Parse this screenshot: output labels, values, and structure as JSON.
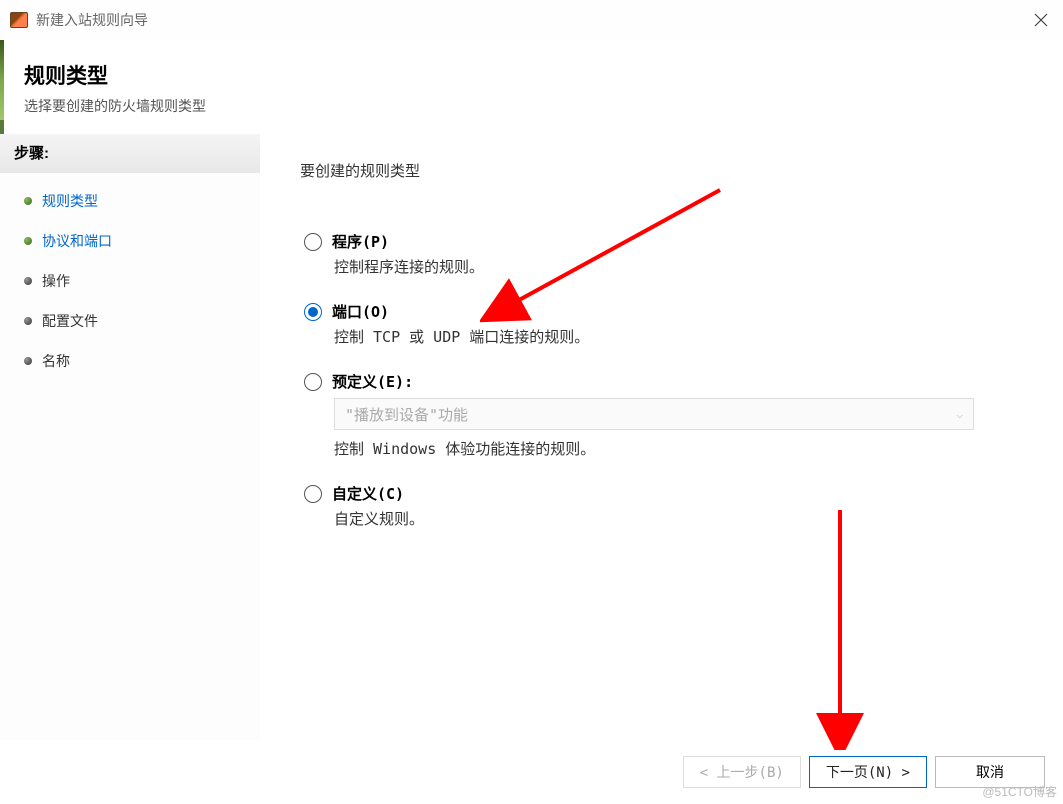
{
  "titlebar": {
    "title": "新建入站规则向导"
  },
  "header": {
    "title": "规则类型",
    "subtitle": "选择要创建的防火墙规则类型"
  },
  "sidebar": {
    "title": "步骤:",
    "items": [
      {
        "label": "规则类型",
        "current": false,
        "link": true
      },
      {
        "label": "协议和端口",
        "current": true,
        "link": true
      },
      {
        "label": "操作",
        "current": false,
        "link": false
      },
      {
        "label": "配置文件",
        "current": false,
        "link": false
      },
      {
        "label": "名称",
        "current": false,
        "link": false
      }
    ]
  },
  "main": {
    "title": "要创建的规则类型",
    "options": [
      {
        "label": "程序(P)",
        "desc": "控制程序连接的规则。",
        "checked": false
      },
      {
        "label": "端口(O)",
        "desc": "控制 TCP 或 UDP 端口连接的规则。",
        "checked": true
      },
      {
        "label": "预定义(E):",
        "desc": "控制 Windows 体验功能连接的规则。",
        "checked": false,
        "dropdown": "\"播放到设备\"功能"
      },
      {
        "label": "自定义(C)",
        "desc": "自定义规则。",
        "checked": false
      }
    ]
  },
  "footer": {
    "back": "< 上一步(B)",
    "next": "下一页(N) >",
    "cancel": "取消"
  },
  "watermark": "@51CTO博客"
}
